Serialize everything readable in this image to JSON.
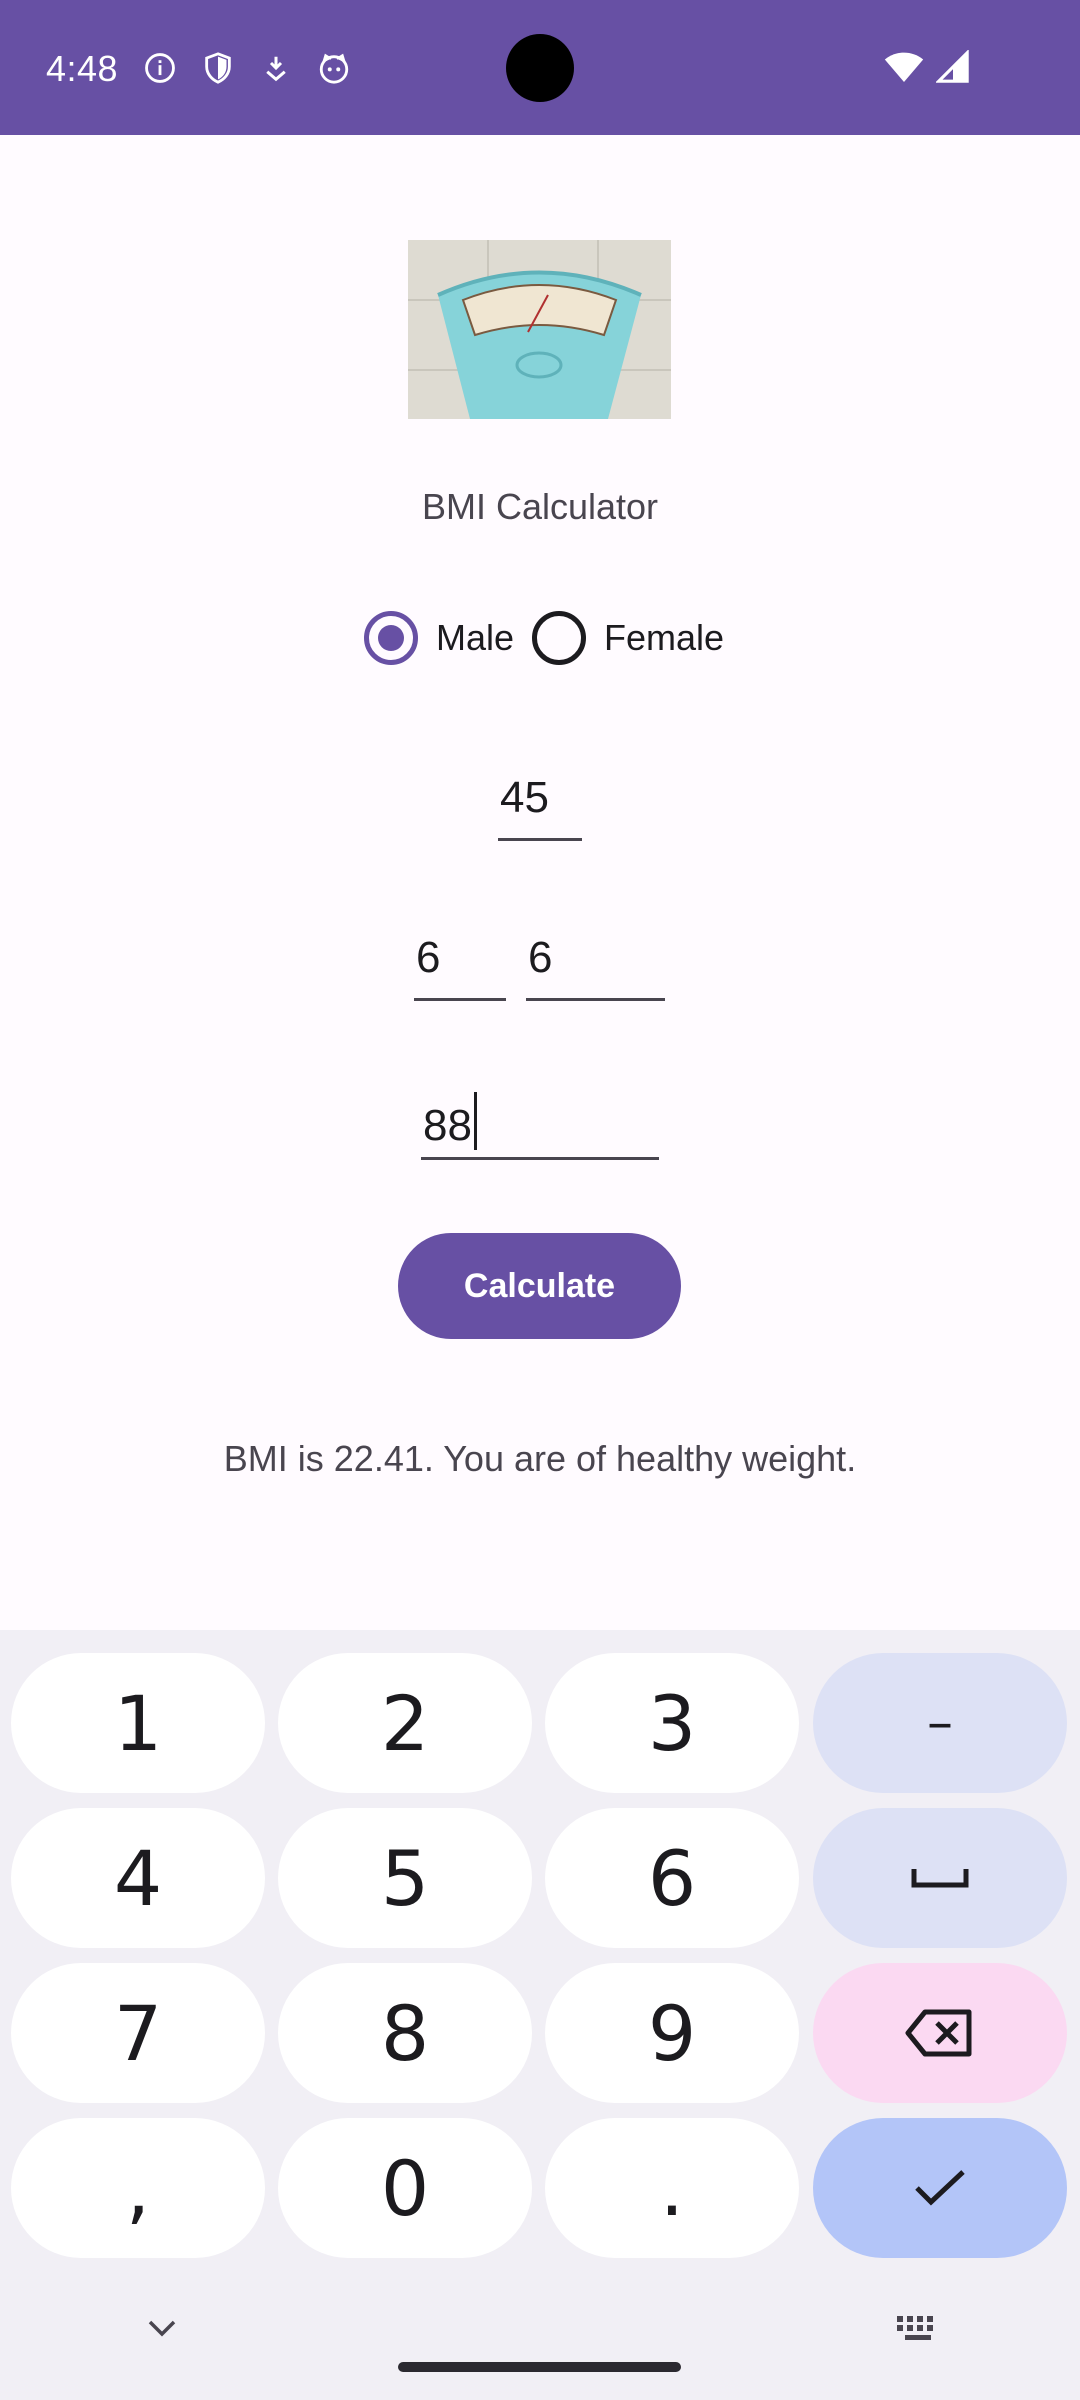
{
  "status_bar": {
    "time": "4:48",
    "left_icons": [
      "info-icon",
      "shield-icon",
      "download-icon",
      "cat-icon"
    ],
    "right_icons": [
      "wifi-icon",
      "signal-icon"
    ],
    "background": "#6750a4"
  },
  "app": {
    "title": "BMI Calculator",
    "hero_image": "scale-photo"
  },
  "gender": {
    "options": [
      "Male",
      "Female"
    ],
    "selected": "Male"
  },
  "inputs": {
    "age": "45",
    "height_feet": "6",
    "height_inches": "6",
    "weight": "88"
  },
  "actions": {
    "calculate_label": "Calculate"
  },
  "result": {
    "text": "BMI is 22.41. You are of healthy weight."
  },
  "keyboard": {
    "keys": [
      "1",
      "2",
      "3",
      "–",
      "4",
      "5",
      "6",
      "␣",
      "7",
      "8",
      "9",
      "⌫",
      ",",
      "0",
      ".",
      "✓"
    ],
    "hide_icon": "chevron-down-icon",
    "switch_icon": "keyboard-icon"
  },
  "colors": {
    "accent": "#6750a4",
    "background": "#fffbff",
    "keyboard_bg": "#f1eff5"
  }
}
